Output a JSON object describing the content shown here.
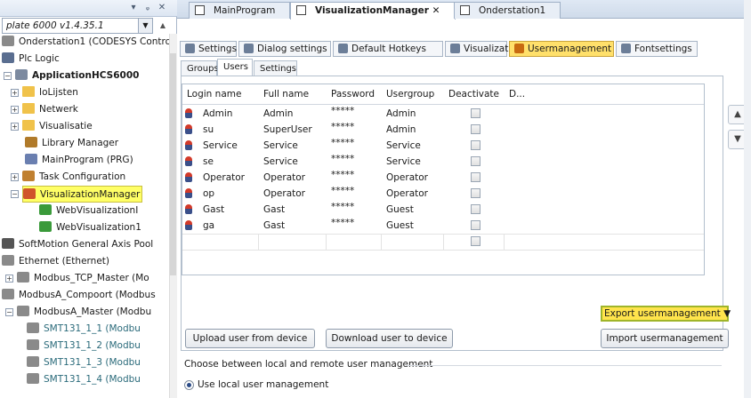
{
  "left_panel": {
    "combo_value": "plate 6000 v1.4.35.1",
    "tree": [
      {
        "label": "Onderstation1 (CODESYS Control",
        "icon": "device-icon"
      },
      {
        "label": "Plc Logic",
        "icon": "plc-logic-icon"
      },
      {
        "label": "ApplicationHCS6000",
        "icon": "application-icon",
        "bold": true
      },
      {
        "label": "IoLijsten",
        "icon": "folder-icon"
      },
      {
        "label": "Netwerk",
        "icon": "folder-icon"
      },
      {
        "label": "Visualisatie",
        "icon": "folder-icon"
      },
      {
        "label": "Library Manager",
        "icon": "library-icon"
      },
      {
        "label": "MainProgram (PRG)",
        "icon": "program-icon"
      },
      {
        "label": "Task Configuration",
        "icon": "task-icon"
      },
      {
        "label": "VisualizationManager",
        "icon": "visualization-manager-icon",
        "selected": true
      },
      {
        "label": "WebVisualizationI",
        "icon": "web-visualization-icon"
      },
      {
        "label": "WebVisualization1",
        "icon": "web-visualization-icon"
      },
      {
        "label": "SoftMotion General Axis Pool",
        "icon": "axis-pool-icon"
      },
      {
        "label": "Ethernet (Ethernet)",
        "icon": "device-icon"
      },
      {
        "label": "Modbus_TCP_Master (Mo",
        "icon": "device-icon"
      },
      {
        "label": "ModbusA_Compoort (Modbus",
        "icon": "device-icon"
      },
      {
        "label": "ModbusA_Master (Modbu",
        "icon": "device-icon"
      },
      {
        "label": "SMT131_1_1 (Modbu",
        "icon": "device-icon"
      },
      {
        "label": "SMT131_1_2 (Modbu",
        "icon": "device-icon"
      },
      {
        "label": "SMT131_1_3 (Modbu",
        "icon": "device-icon"
      },
      {
        "label": "SMT131_1_4 (Modbu",
        "icon": "device-icon"
      }
    ]
  },
  "doc_tabs": [
    {
      "label": "MainProgram"
    },
    {
      "label": "VisualizationManager",
      "active": true
    },
    {
      "label": "Onderstation1"
    }
  ],
  "editor_tabs": [
    {
      "label": "Settings"
    },
    {
      "label": "Dialog settings"
    },
    {
      "label": "Default Hotkeys"
    },
    {
      "label": "Visualizations"
    },
    {
      "label": "Usermanagement",
      "active": true
    },
    {
      "label": "Fontsettings"
    }
  ],
  "inner_tabs": [
    {
      "label": "Groups"
    },
    {
      "label": "Users",
      "active": true
    },
    {
      "label": "Settings"
    }
  ],
  "table": {
    "headers": [
      "Login name",
      "Full name",
      "Password",
      "Usergroup",
      "Deactivate",
      "D..."
    ],
    "rows": [
      [
        "Admin",
        "Admin",
        "*****",
        "Admin"
      ],
      [
        "su",
        "SuperUser",
        "*****",
        "Admin"
      ],
      [
        "Service",
        "Service",
        "*****",
        "Service"
      ],
      [
        "se",
        "Service",
        "*****",
        "Service"
      ],
      [
        "Operator",
        "Operator",
        "*****",
        "Operator"
      ],
      [
        "op",
        "Operator",
        "*****",
        "Operator"
      ],
      [
        "Gast",
        "Gast",
        "*****",
        "Guest"
      ],
      [
        "ga",
        "Gast",
        "*****",
        "Guest"
      ],
      [
        "",
        "",
        "",
        ""
      ]
    ]
  },
  "buttons": {
    "export": "Export usermanagement ▼",
    "upload": "Upload user from device",
    "download": "Download user to device",
    "import": "Import usermanagement"
  },
  "footer": {
    "section_label": "Choose between local and remote user management",
    "radio_label": "Use local user management"
  },
  "colors": {
    "selection_highlight": "#ffff66",
    "active_tab": "#ffe06b",
    "export_button": "#ffe44c"
  }
}
